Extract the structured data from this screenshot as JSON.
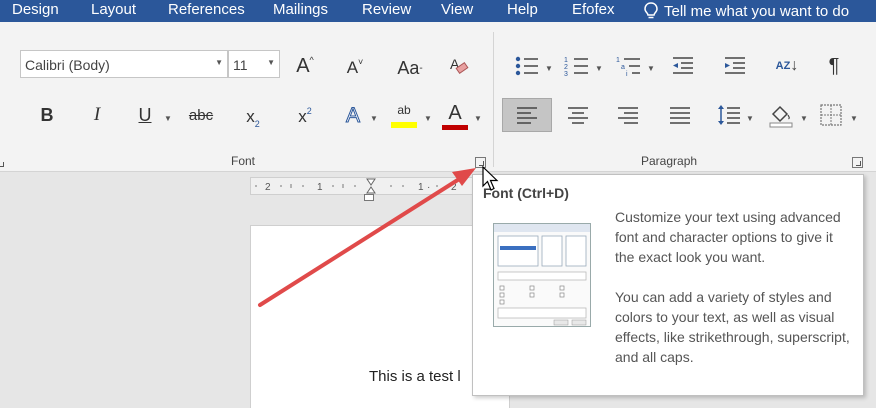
{
  "tabs": [
    "Design",
    "Layout",
    "References",
    "Mailings",
    "Review",
    "View",
    "Help",
    "Efofex"
  ],
  "tell_me": "Tell me what you want to do",
  "font_group": {
    "font_name": "Calibri (Body)",
    "font_size": "11",
    "label": "Font",
    "grow_label": "A",
    "shrink_label": "A",
    "case_label": "Aa",
    "bold": "B",
    "italic": "I",
    "underline": "U",
    "strike": "abc",
    "subscript": "x",
    "superscript": "x",
    "effects": "A",
    "highlight": "ab",
    "font_color": "A"
  },
  "paragraph_group": {
    "label": "Paragraph",
    "sort": "AZ",
    "pilcrow": "¶"
  },
  "tooltip": {
    "title": "Font (Ctrl+D)",
    "para1": "Customize your text using advanced font and character options to give it the exact look you want.",
    "para2": "You can add a variety of styles and colors to your text, as well as visual effects, like strikethrough, superscript, and all caps."
  },
  "document": {
    "text": "This is a test l"
  },
  "colors": {
    "ribbon_tab_bg": "#2b579a",
    "highlight_yellow": "#ffff00",
    "font_color_red": "#c00000",
    "arrow_red": "#e04a4a"
  }
}
